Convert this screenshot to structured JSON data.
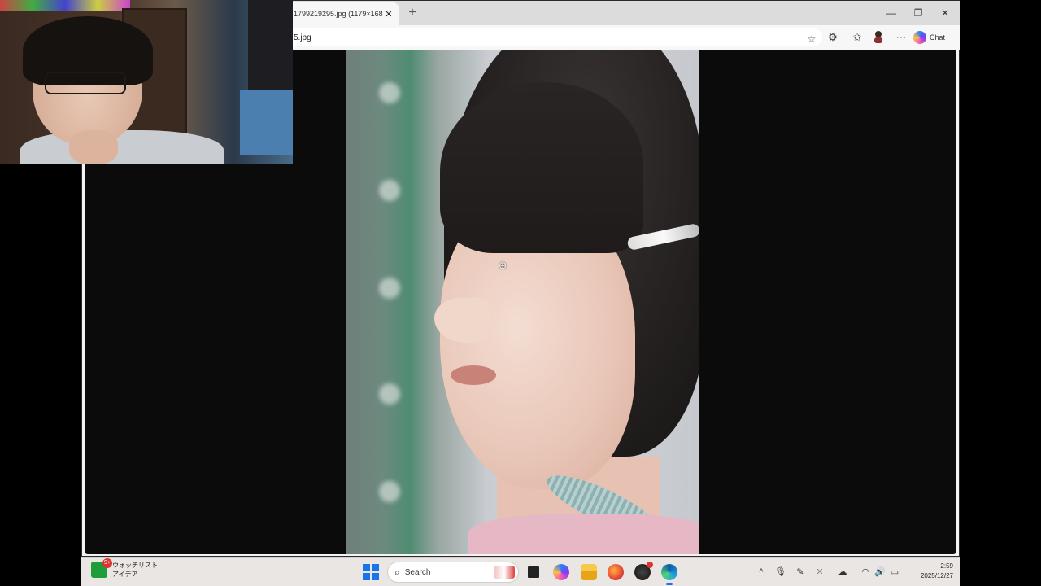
{
  "browser": {
    "tab_title": "1799219295.jpg (1179×168",
    "tab_close": "✕",
    "new_tab": "+",
    "minimize": "—",
    "restore": "❐",
    "close": "✕",
    "url": "5.jpg",
    "chat_label": "Chat"
  },
  "viewer": {
    "image_kind": "portrait photo",
    "cursor": "⊕"
  },
  "taskbar": {
    "widget_title": "ウォッチリスト",
    "widget_subtitle": "アイデア",
    "widget_badge": "9+",
    "search_label": "Search",
    "time": "2:59",
    "date": "2025/12/27"
  },
  "colors": {
    "accent": "#1a73e8",
    "taskbar_bg": "#eae6e4",
    "content_bg": "#0b0b0b"
  }
}
